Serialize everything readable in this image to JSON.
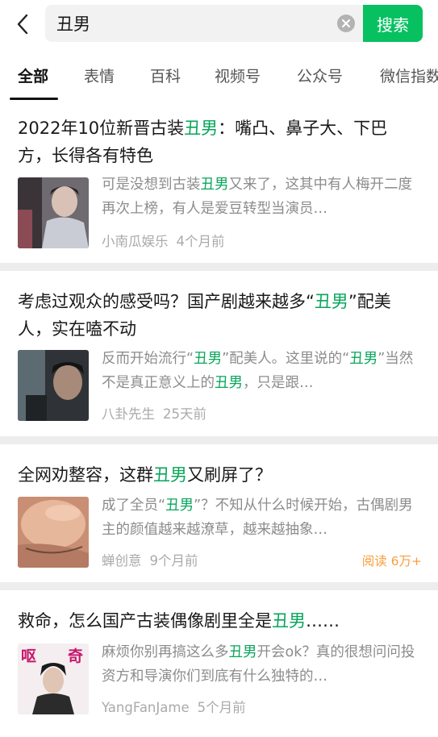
{
  "search": {
    "query": "丑男",
    "button_label": "搜索"
  },
  "tabs": [
    {
      "label": "全部",
      "active": true
    },
    {
      "label": "表情",
      "active": false
    },
    {
      "label": "百科",
      "active": false
    },
    {
      "label": "视频号",
      "active": false
    },
    {
      "label": "公众号",
      "active": false
    },
    {
      "label": "微信指数",
      "active": false
    }
  ],
  "results": [
    {
      "title_parts": [
        "2022年10位新晋古装",
        "丑男",
        "：嘴凸、鼻子大、下巴方，长得各有特色"
      ],
      "snippet_parts": [
        "可是没想到古装",
        "丑男",
        "又来了，这其中有人梅开二度再次上榜，有人是爱豆转型当演员…"
      ],
      "source": "小南瓜娱乐",
      "time": "4个月前",
      "reads": ""
    },
    {
      "title_parts": [
        "考虑过观众的感受吗？国产剧越来越多“",
        "丑男",
        "”配美人，实在嗑不动"
      ],
      "snippet_parts": [
        "反而开始流行“",
        "丑男",
        "”配美人。这里说的“",
        "丑男",
        "”当然不是真正意义上的",
        "丑男",
        "，只是跟…"
      ],
      "source": "八卦先生",
      "time": "25天前",
      "reads": ""
    },
    {
      "title_parts": [
        "全网劝整容，这群",
        "丑男",
        "又刷屏了？"
      ],
      "snippet_parts": [
        "成了全员“",
        "丑男",
        "”？不知从什么时候开始，古偶剧男主的颜值越来越潦草，越来越抽象…"
      ],
      "source": "蝉创意",
      "time": "9个月前",
      "reads": "阅读 6万+"
    },
    {
      "title_parts": [
        "救命，怎么国产古装偶像剧里全是",
        "丑男",
        "……"
      ],
      "snippet_parts": [
        "麻烦你别再搞这么多",
        "丑男",
        "开会ok？真的很想问问投资方和导演你们到底有什么独特的…"
      ],
      "source": "YangFanJame",
      "time": "5个月前",
      "reads": "",
      "thumb_text": [
        "呕",
        "奇"
      ]
    }
  ],
  "colors": {
    "accent": "#07c160",
    "highlight": "#07a65a",
    "reads": "#fa9d3b"
  },
  "icons": {
    "back": "back-arrow-icon",
    "clear": "clear-icon"
  }
}
